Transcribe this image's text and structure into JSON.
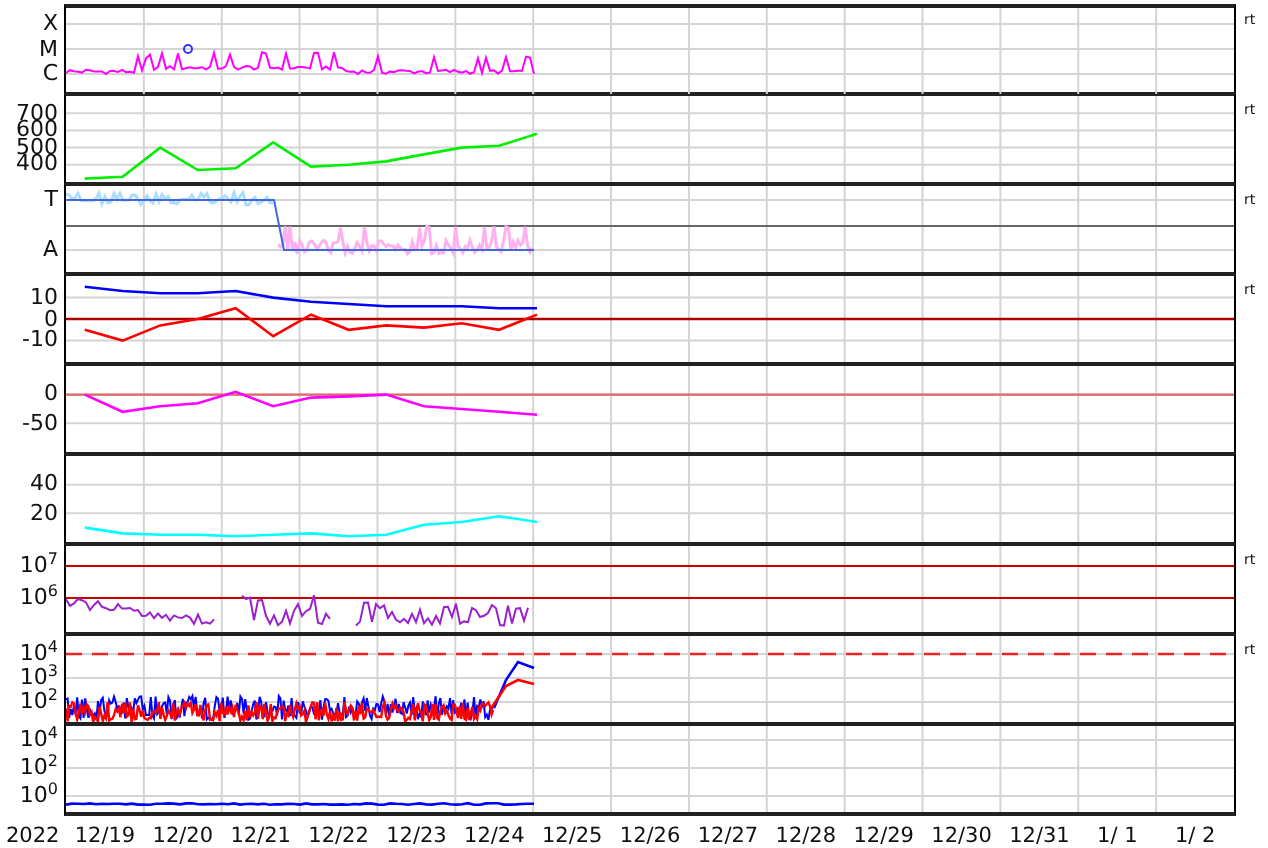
{
  "panels": [
    {
      "kind": "xray",
      "side_label": "rt",
      "y_labels": [
        "X",
        "M",
        "C"
      ]
    },
    {
      "kind": "chart",
      "side_label": "rt",
      "chart_data": {
        "type": "line",
        "grid": true,
        "ylim": [
          300,
          800
        ],
        "categories": [
          null,
          null,
          null,
          null,
          null,
          null,
          null,
          null,
          null,
          null,
          null,
          null,
          null,
          null,
          null,
          null,
          null,
          null,
          null,
          null,
          null,
          null,
          null,
          null,
          null,
          null,
          null,
          null,
          null,
          null,
          null
        ],
        "yticks": [
          400,
          500,
          600,
          700
        ],
        "series": [
          {
            "color": "#00ee00",
            "values": [
              320,
              330,
              500,
              370,
              380,
              530,
              390,
              400,
              420,
              460,
              500,
              510,
              580,
              null,
              null,
              null,
              null,
              null,
              null,
              null,
              null,
              null,
              null,
              null,
              null,
              null,
              null,
              null,
              null,
              null,
              null
            ]
          }
        ]
      }
    },
    {
      "kind": "sector",
      "side_label": "rt",
      "y_labels": [
        "T",
        "A"
      ]
    },
    {
      "kind": "chart",
      "side_label": "rt",
      "chart_data": {
        "type": "line",
        "grid": true,
        "ylim": [
          -20,
          20
        ],
        "categories": [
          null,
          null,
          null,
          null,
          null,
          null,
          null,
          null,
          null,
          null,
          null,
          null,
          null,
          null,
          null,
          null,
          null,
          null,
          null,
          null,
          null,
          null,
          null,
          null,
          null,
          null,
          null,
          null,
          null,
          null,
          null
        ],
        "yticks": [
          -10,
          0,
          10
        ],
        "series": [
          {
            "color": "#0000ff",
            "values": [
              15,
              13,
              12,
              12,
              13,
              10,
              8,
              7,
              6,
              6,
              6,
              5,
              5,
              null,
              null,
              null,
              null,
              null,
              null,
              null,
              null,
              null,
              null,
              null,
              null,
              null,
              null,
              null,
              null,
              null,
              null
            ]
          },
          {
            "color": "#ff0000",
            "values": [
              -5,
              -10,
              -3,
              0,
              5,
              -8,
              2,
              -5,
              -3,
              -4,
              -2,
              -5,
              2,
              null,
              null,
              null,
              null,
              null,
              null,
              null,
              null,
              null,
              null,
              null,
              null,
              null,
              null,
              null,
              null,
              null,
              null
            ]
          }
        ],
        "ref_lines": [
          {
            "axis": "y",
            "value": 0,
            "color": "#aa0000"
          }
        ]
      }
    },
    {
      "kind": "chart",
      "chart_data": {
        "type": "line",
        "grid": true,
        "ylim": [
          -100,
          50
        ],
        "categories": [
          null,
          null,
          null,
          null,
          null,
          null,
          null,
          null,
          null,
          null,
          null,
          null,
          null,
          null,
          null,
          null,
          null,
          null,
          null,
          null,
          null,
          null,
          null,
          null,
          null,
          null,
          null,
          null,
          null,
          null,
          null
        ],
        "yticks": [
          -50,
          0
        ],
        "series": [
          {
            "color": "#ff00ff",
            "values": [
              0,
              -30,
              -20,
              -15,
              5,
              -20,
              -5,
              -3,
              0,
              -20,
              -25,
              -30,
              -35,
              null,
              null,
              null,
              null,
              null,
              null,
              null,
              null,
              null,
              null,
              null,
              null,
              null,
              null,
              null,
              null,
              null,
              null
            ]
          }
        ],
        "ref_lines": [
          {
            "axis": "y",
            "value": 0,
            "color": "#dd6666"
          }
        ]
      }
    },
    {
      "kind": "chart",
      "chart_data": {
        "type": "line",
        "grid": true,
        "ylim": [
          0,
          60
        ],
        "categories": [
          null,
          null,
          null,
          null,
          null,
          null,
          null,
          null,
          null,
          null,
          null,
          null,
          null,
          null,
          null,
          null,
          null,
          null,
          null,
          null,
          null,
          null,
          null,
          null,
          null,
          null,
          null,
          null,
          null,
          null,
          null
        ],
        "yticks": [
          20,
          40
        ],
        "series": [
          {
            "color": "#00ffff",
            "values": [
              10,
              6,
              5,
              5,
              4,
              5,
              6,
              4,
              5,
              12,
              14,
              18,
              14,
              null,
              null,
              null,
              null,
              null,
              null,
              null,
              null,
              null,
              null,
              null,
              null,
              null,
              null,
              null,
              null,
              null,
              null
            ]
          }
        ]
      }
    },
    {
      "kind": "electron",
      "side_label": "rt",
      "y_labels": [
        "10$^{7}$",
        "10$^{6}$"
      ]
    },
    {
      "kind": "proton",
      "side_label": "rt",
      "y_labels": [
        "10$^{4}$",
        "10$^{3}$",
        "10$^{2}$"
      ]
    },
    {
      "kind": "flux",
      "y_labels": [
        "10$^{4}$",
        "10$^{2}$",
        "10$^{0}$"
      ]
    }
  ],
  "x_axis": {
    "year": "2022",
    "labels": [
      "12/19",
      "12/20",
      "12/21",
      "12/22",
      "12/23",
      "12/24",
      "12/25",
      "12/26",
      "12/27",
      "12/28",
      "12/29",
      "12/30",
      "12/31",
      "1/ 1",
      "1/ 2"
    ]
  }
}
